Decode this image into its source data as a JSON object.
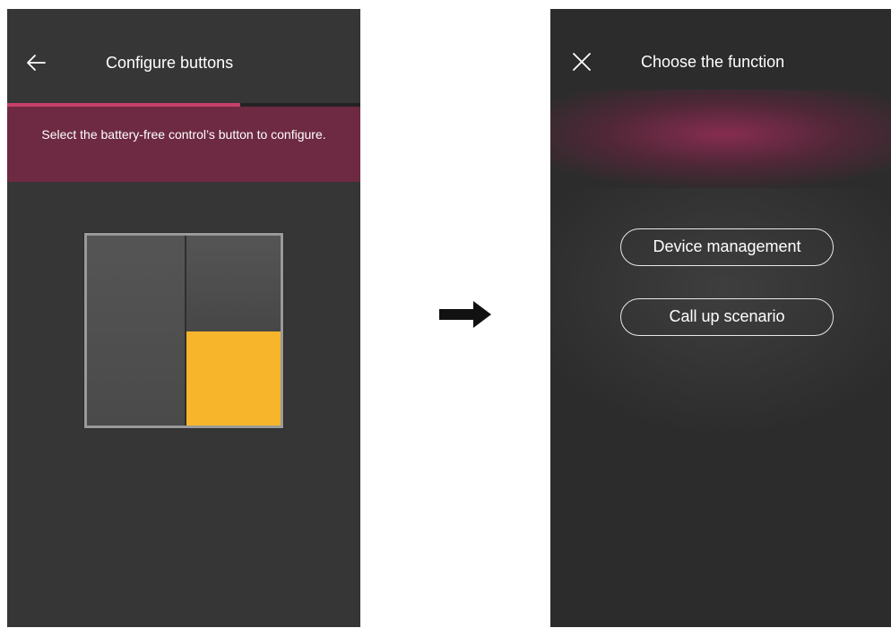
{
  "left_screen": {
    "header": {
      "title": "Configure buttons",
      "back_icon": "arrow-left-icon"
    },
    "progress": {
      "fraction": 0.66,
      "color": "#c8406a"
    },
    "banner": {
      "text": "Select the battery-free control’s button to configure."
    },
    "switch": {
      "highlight_color": "#f6b52a",
      "selected_button": "right-bottom"
    }
  },
  "transition": {
    "icon": "arrow-right-icon"
  },
  "right_screen": {
    "header": {
      "title": "Choose the function",
      "close_icon": "close-icon"
    },
    "options": [
      {
        "label": "Device management"
      },
      {
        "label": "Call up scenario"
      }
    ]
  }
}
